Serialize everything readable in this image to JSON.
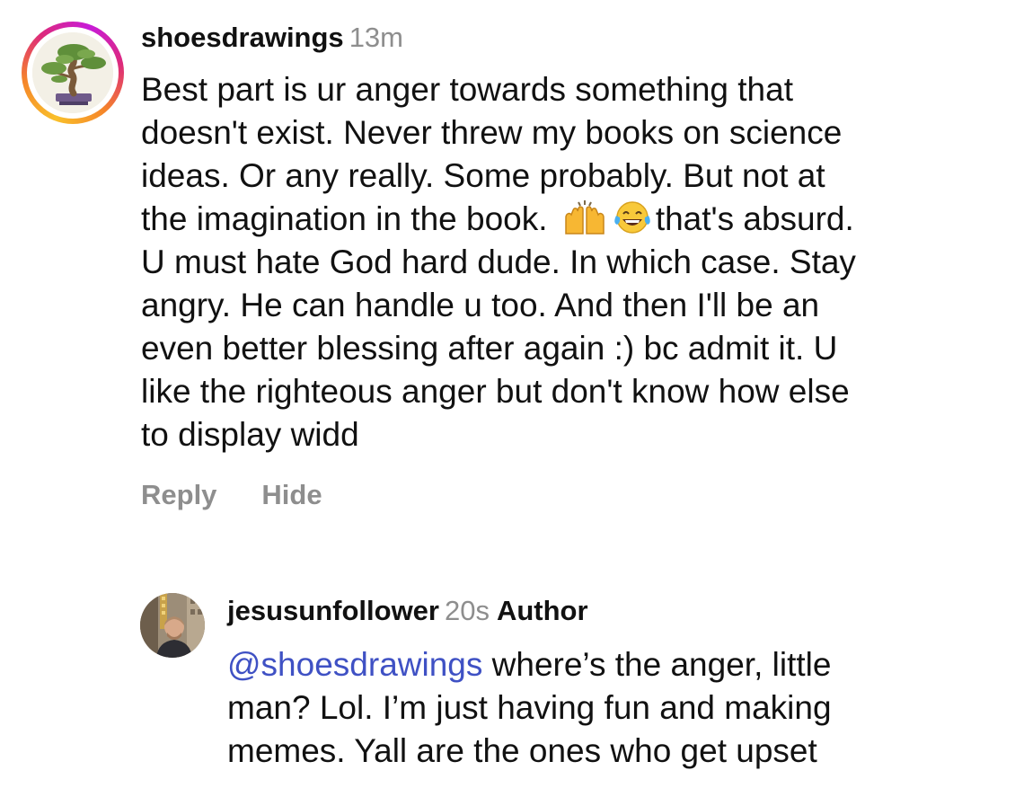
{
  "comment1": {
    "username": "shoesdrawings",
    "time": "13m",
    "avatar_icon": "bonsai-tree-avatar",
    "story_ring_colors": [
      "#f9c02b",
      "#f58529",
      "#dd2a7b",
      "#c71bd8"
    ],
    "lines": [
      "Best part is ur anger towards something that",
      "doesn't exist. Never threw my books on science",
      "ideas. Or any really. Some probably. But not at"
    ],
    "line4_before": "the imagination in the book.",
    "emoji_1": "raising-hands-emoji",
    "emoji_2": "tears-of-joy-emoji",
    "line4_after": "that's absurd.",
    "lines_after": [
      "U must hate God hard dude. In which case. Stay",
      "angry. He can handle u too. And then I'll be an",
      "even better blessing after again :) bc admit it. U",
      "like the righteous anger but don't know how else",
      "to display widd"
    ],
    "reply_label": "Reply",
    "hide_label": "Hide"
  },
  "comment2": {
    "username": "jesusunfollower",
    "time": "20s",
    "author_badge": "Author",
    "avatar_icon": "user-photo-avatar",
    "mention": "@shoesdrawings",
    "line1_after_mention": " where’s the anger, little",
    "lines": [
      "man? Lol. I’m just having fun and making",
      "memes. Yall are the ones who get upset"
    ]
  },
  "colors": {
    "text": "#111111",
    "muted": "#8e8e8e",
    "mention": "#3f51c4"
  }
}
